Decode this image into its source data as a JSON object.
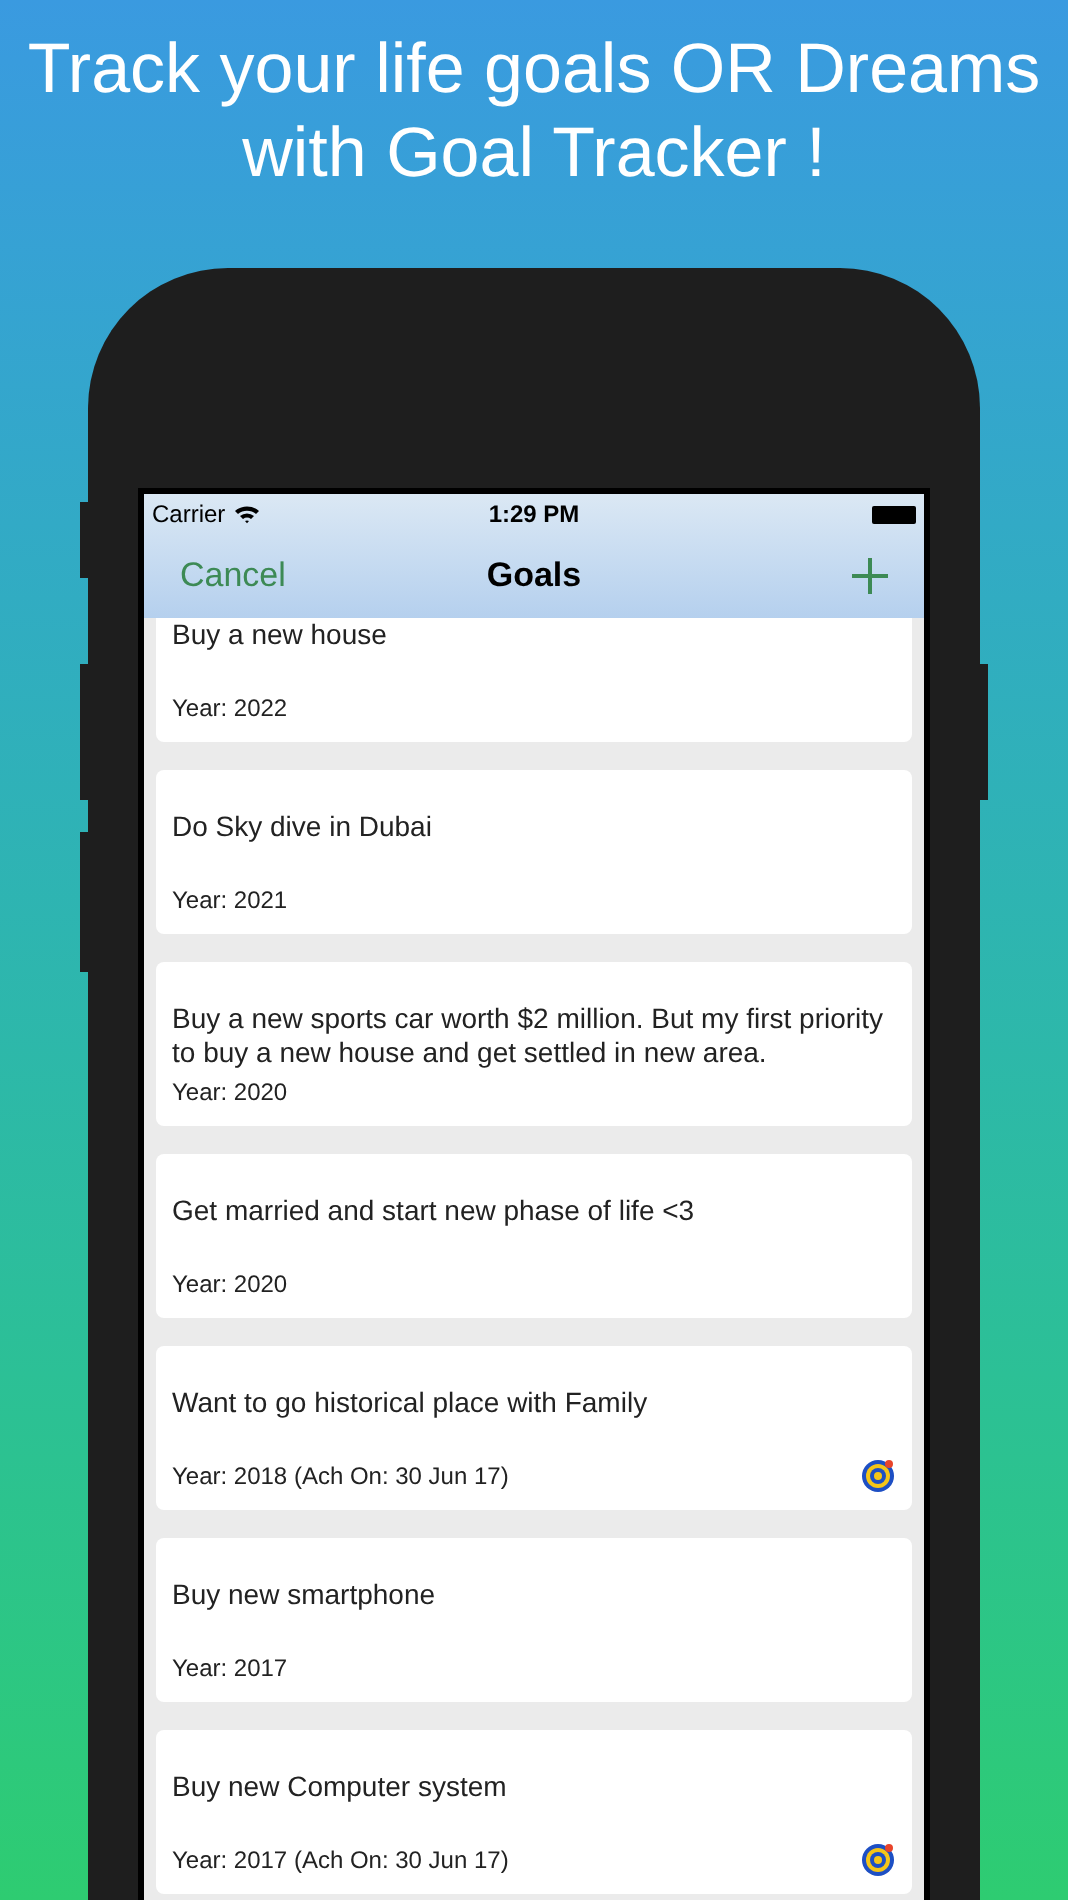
{
  "headline": "Track your life goals OR Dreams with Goal Tracker !",
  "status_bar": {
    "carrier": "Carrier",
    "time": "1:29 PM"
  },
  "nav": {
    "left": "Cancel",
    "title": "Goals"
  },
  "goals": [
    {
      "title": "Buy a new house",
      "year": "Year: 2022",
      "achieved": false
    },
    {
      "title": "Do Sky dive in Dubai",
      "year": "Year: 2021",
      "achieved": false
    },
    {
      "title": "Buy a new sports car worth $2 million. But my first priority to buy a new house and get settled in new area.",
      "year": "Year: 2020",
      "achieved": false
    },
    {
      "title": "Get married and start new phase of life <3",
      "year": "Year: 2020",
      "achieved": false
    },
    {
      "title": "Want to go historical place with Family",
      "year": "Year: 2018 (Ach On: 30 Jun 17)",
      "achieved": true
    },
    {
      "title": "Buy new smartphone",
      "year": "Year: 2017",
      "achieved": false
    },
    {
      "title": "Buy new Computer system",
      "year": "Year: 2017 (Ach On: 30 Jun 17)",
      "achieved": true
    }
  ]
}
